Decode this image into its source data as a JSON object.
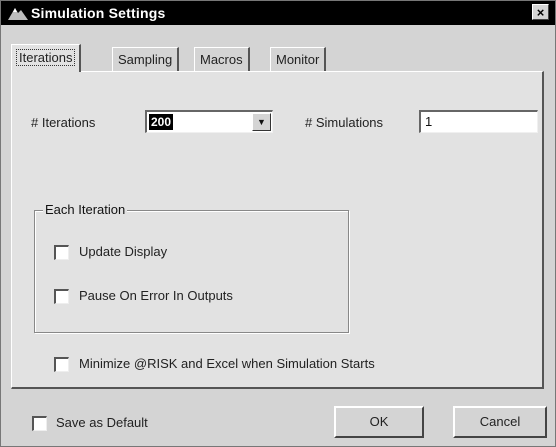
{
  "window": {
    "title": "Simulation Settings",
    "close_glyph": "×"
  },
  "tabs": [
    {
      "label": "Iterations",
      "active": true
    },
    {
      "label": "Sampling",
      "active": false
    },
    {
      "label": "Macros",
      "active": false
    },
    {
      "label": "Monitor",
      "active": false
    }
  ],
  "iterations": {
    "iterations_label": "# Iterations",
    "iterations_value": "200",
    "simulations_label": "# Simulations",
    "simulations_value": "1"
  },
  "each_iteration": {
    "legend": "Each Iteration",
    "update_display": {
      "label": "Update Display",
      "checked": false
    },
    "pause_on_error": {
      "label": "Pause On Error In Outputs",
      "checked": false
    }
  },
  "minimize": {
    "label": "Minimize @RISK and Excel when Simulation Starts",
    "checked": false
  },
  "footer": {
    "save_default": {
      "label": "Save as Default",
      "checked": false
    },
    "ok_label": "OK",
    "cancel_label": "Cancel"
  },
  "icons": {
    "title_icon": "risk-app-icon",
    "dropdown_icon": "chevron-down-icon"
  }
}
